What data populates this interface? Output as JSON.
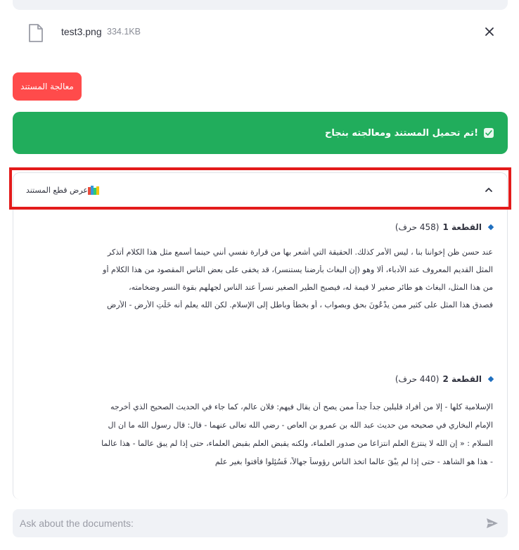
{
  "file": {
    "name": "test3.png",
    "size": "334.1KB"
  },
  "process_button": {
    "label": "معالجة المستند"
  },
  "success": {
    "message": "تم تحميل المستند ومعالجته بنجاح!"
  },
  "expander": {
    "title": "عرض قطع المستند"
  },
  "chunks": [
    {
      "label": "القطعة 1",
      "count": "(458 حرف)",
      "lines": [
        "عند حسن ظن إخواننا بنا ، ليس الأمر كذلك. الحقيقة التي أشعر بها من قرارة نفسي أنني حينما أسمع مثل هذا الكلام أتذكر",
        "المثل القديم المعروف عند الأدباء، ألا وهو (إن البغاث بأرضنا يستنسر)، قد يخفى على بعض الناس المقصود من هذا الكلام أو",
        "من هذا المثل، البغاث هو طائر صغير لا قيمة له، فيصبح الطير الصغير نسراً عند الناس لجهلهم بقوة النسر وضخامته،",
        "فصدق هذا المثل على كثير ممن يدْعُونَ بحق وبصواب ، أو بخطأ وباطل إلى الإسلام. لكن الله يعلم أنه خَلَتِ الأرض - الأرض"
      ]
    },
    {
      "label": "القطعة 2",
      "count": "(440 حرف)",
      "lines": [
        "الإسلامية كلها - إلا من أفراد قليلين جداً جداً ممن يصح أن يقال فيهم: فلان عالم، كما جاء في الحديث الصحيح الذي أخرجه",
        "الإمام البخاري في صحيحه من حديث عبد الله بن عمرو بن العاص - رضي الله تعالى عنهما - قال: قال رسول الله ما ان ال",
        "السلام : « إن الله لا ينتزع العلم انتزاعا من صدور العلماء، ولكنه يقبض العلم بقبض العلماء، حتى إذا لم يبق عالما - هذا عالما",
        "- هذا هو الشاهد - حتى إذا لم يبْقَ عالما اتخذ الناس رؤوساً جهالاً، فَسُئِلوا فأفتوا بغير علم"
      ]
    }
  ],
  "chat": {
    "placeholder": "Ask about the documents:"
  },
  "colors": {
    "primary": "#ff4b4b",
    "success": "#21ad5c",
    "highlight": "#e31b1b"
  },
  "icons": {
    "file": "file-icon",
    "close": "close-icon",
    "check": "check-icon",
    "books": "books-icon",
    "chevron": "chevron-up-icon",
    "send": "send-icon"
  }
}
